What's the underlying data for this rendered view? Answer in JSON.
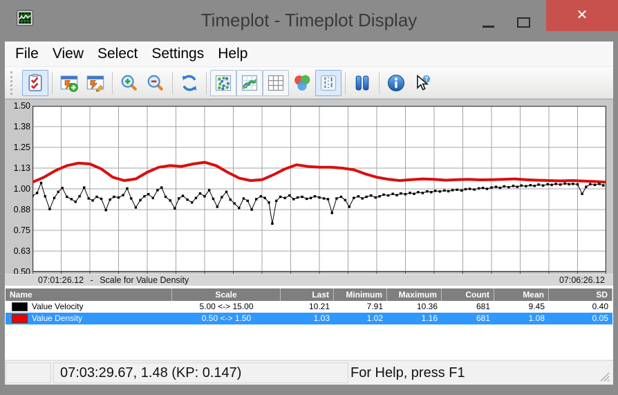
{
  "window": {
    "title": "Timeplot - Timeplot Display",
    "controls": {
      "minimize": "minimize",
      "maximize": "maximize",
      "close_glyph": "✕"
    },
    "colors": {
      "titlebar": "#8b8b8b",
      "close_button": "#c9514d",
      "selection_blue": "#2f97fe",
      "plot_red": "#d90f0f"
    }
  },
  "menu": {
    "items": [
      "File",
      "View",
      "Select",
      "Settings",
      "Help"
    ]
  },
  "toolbar": {
    "groups": [
      [
        {
          "name": "select-plots-button",
          "icon": "checklist-icon",
          "style": "selected"
        }
      ],
      [
        {
          "name": "add-plot-button",
          "icon": "add-plot-icon",
          "style": "plain"
        },
        {
          "name": "edit-plot-button",
          "icon": "edit-plot-icon",
          "style": "plain"
        }
      ],
      [
        {
          "name": "zoom-in-button",
          "icon": "zoom-in-icon",
          "style": "plain"
        },
        {
          "name": "zoom-out-button",
          "icon": "zoom-out-icon",
          "style": "plain"
        }
      ],
      [
        {
          "name": "refresh-button",
          "icon": "refresh-icon",
          "style": "plain"
        }
      ],
      [
        {
          "name": "scatter-style-button",
          "icon": "scatter-plot-icon",
          "style": "framed"
        },
        {
          "name": "line-style-button",
          "icon": "line-plot-icon",
          "style": "framed"
        },
        {
          "name": "grid-toggle-button",
          "icon": "grid-icon",
          "style": "framed"
        },
        {
          "name": "color-mix-button",
          "icon": "color-circles-icon",
          "style": "plain"
        },
        {
          "name": "marker-lines-button",
          "icon": "marker-lines-icon",
          "style": "selected"
        }
      ],
      [
        {
          "name": "pause-button",
          "icon": "pause-icon",
          "style": "plain"
        }
      ],
      [
        {
          "name": "info-button",
          "icon": "info-icon",
          "style": "plain"
        },
        {
          "name": "context-help-button",
          "icon": "help-cursor-icon",
          "style": "plain"
        }
      ]
    ]
  },
  "chart_data": {
    "type": "line",
    "title": "",
    "x_axis": {
      "start_label": "07:01:26.12",
      "end_label": "07:06:26.12",
      "separator": "-",
      "divisions": 20
    },
    "y_axis": {
      "min": 0.5,
      "max": 1.5,
      "tick_labels": [
        "1.50",
        "1.38",
        "1.25",
        "1.13",
        "1.00",
        "0.88",
        "0.75",
        "0.63",
        "0.50"
      ],
      "tick_values": [
        1.5,
        1.375,
        1.25,
        1.125,
        1.0,
        0.875,
        0.75,
        0.625,
        0.5
      ],
      "scale_label": "Scale for Value Density"
    },
    "grid": true,
    "series": [
      {
        "name": "Value Velocity",
        "color": "#000000",
        "marker": "square",
        "line_width": 1,
        "scale_min": 5.0,
        "scale_max": 15.0,
        "points": [
          [
            0.0,
            9.58
          ],
          [
            0.008,
            9.75
          ],
          [
            0.015,
            10.36
          ],
          [
            0.022,
            9.55
          ],
          [
            0.03,
            8.78
          ],
          [
            0.038,
            9.45
          ],
          [
            0.045,
            9.82
          ],
          [
            0.052,
            10.05
          ],
          [
            0.06,
            9.52
          ],
          [
            0.068,
            9.38
          ],
          [
            0.075,
            9.22
          ],
          [
            0.082,
            9.55
          ],
          [
            0.09,
            10.08
          ],
          [
            0.098,
            9.42
          ],
          [
            0.105,
            9.3
          ],
          [
            0.112,
            9.52
          ],
          [
            0.12,
            9.4
          ],
          [
            0.128,
            8.72
          ],
          [
            0.135,
            9.35
          ],
          [
            0.142,
            9.52
          ],
          [
            0.15,
            9.48
          ],
          [
            0.158,
            9.62
          ],
          [
            0.165,
            10.02
          ],
          [
            0.172,
            9.42
          ],
          [
            0.18,
            8.88
          ],
          [
            0.188,
            9.32
          ],
          [
            0.195,
            9.55
          ],
          [
            0.202,
            9.68
          ],
          [
            0.21,
            9.45
          ],
          [
            0.218,
            9.92
          ],
          [
            0.225,
            10.08
          ],
          [
            0.232,
            9.52
          ],
          [
            0.24,
            9.3
          ],
          [
            0.248,
            8.82
          ],
          [
            0.255,
            9.42
          ],
          [
            0.262,
            9.58
          ],
          [
            0.27,
            9.35
          ],
          [
            0.278,
            9.18
          ],
          [
            0.285,
            9.45
          ],
          [
            0.292,
            9.72
          ],
          [
            0.3,
            9.55
          ],
          [
            0.308,
            9.92
          ],
          [
            0.315,
            9.4
          ],
          [
            0.322,
            8.92
          ],
          [
            0.33,
            9.5
          ],
          [
            0.338,
            9.82
          ],
          [
            0.345,
            9.35
          ],
          [
            0.352,
            9.12
          ],
          [
            0.36,
            8.85
          ],
          [
            0.368,
            9.42
          ],
          [
            0.375,
            9.28
          ],
          [
            0.382,
            8.75
          ],
          [
            0.39,
            9.38
          ],
          [
            0.398,
            9.55
          ],
          [
            0.405,
            9.45
          ],
          [
            0.412,
            9.18
          ],
          [
            0.418,
            7.91
          ],
          [
            0.425,
            9.28
          ],
          [
            0.432,
            9.52
          ],
          [
            0.44,
            9.45
          ],
          [
            0.448,
            9.6
          ],
          [
            0.455,
            9.38
          ],
          [
            0.462,
            9.48
          ],
          [
            0.47,
            9.52
          ],
          [
            0.478,
            9.4
          ],
          [
            0.485,
            9.45
          ],
          [
            0.492,
            9.55
          ],
          [
            0.5,
            9.48
          ],
          [
            0.508,
            9.42
          ],
          [
            0.515,
            9.38
          ],
          [
            0.522,
            8.55
          ],
          [
            0.53,
            9.42
          ],
          [
            0.538,
            9.52
          ],
          [
            0.545,
            9.32
          ],
          [
            0.552,
            8.92
          ],
          [
            0.56,
            9.45
          ],
          [
            0.568,
            9.55
          ],
          [
            0.575,
            9.42
          ],
          [
            0.582,
            9.52
          ],
          [
            0.59,
            9.6
          ],
          [
            0.598,
            9.48
          ],
          [
            0.605,
            9.55
          ],
          [
            0.612,
            9.65
          ],
          [
            0.62,
            9.6
          ],
          [
            0.628,
            9.7
          ],
          [
            0.635,
            9.62
          ],
          [
            0.642,
            9.72
          ],
          [
            0.65,
            9.68
          ],
          [
            0.658,
            9.76
          ],
          [
            0.665,
            9.7
          ],
          [
            0.672,
            9.8
          ],
          [
            0.68,
            9.75
          ],
          [
            0.688,
            9.85
          ],
          [
            0.695,
            9.8
          ],
          [
            0.702,
            9.88
          ],
          [
            0.71,
            9.84
          ],
          [
            0.718,
            9.9
          ],
          [
            0.725,
            9.86
          ],
          [
            0.732,
            9.92
          ],
          [
            0.74,
            9.95
          ],
          [
            0.748,
            9.9
          ],
          [
            0.755,
            9.98
          ],
          [
            0.762,
            10.0
          ],
          [
            0.77,
            9.96
          ],
          [
            0.778,
            10.03
          ],
          [
            0.785,
            10.06
          ],
          [
            0.792,
            10.0
          ],
          [
            0.8,
            10.08
          ],
          [
            0.808,
            10.12
          ],
          [
            0.815,
            10.06
          ],
          [
            0.822,
            10.15
          ],
          [
            0.83,
            10.1
          ],
          [
            0.838,
            10.18
          ],
          [
            0.845,
            10.12
          ],
          [
            0.852,
            10.2
          ],
          [
            0.86,
            10.16
          ],
          [
            0.868,
            10.22
          ],
          [
            0.875,
            10.18
          ],
          [
            0.882,
            10.26
          ],
          [
            0.89,
            10.2
          ],
          [
            0.898,
            10.28
          ],
          [
            0.905,
            10.24
          ],
          [
            0.912,
            10.3
          ],
          [
            0.92,
            10.26
          ],
          [
            0.928,
            10.32
          ],
          [
            0.935,
            10.28
          ],
          [
            0.942,
            10.3
          ],
          [
            0.95,
            10.27
          ],
          [
            0.958,
            9.7
          ],
          [
            0.965,
            10.12
          ],
          [
            0.972,
            10.28
          ],
          [
            0.98,
            10.24
          ],
          [
            0.988,
            10.3
          ],
          [
            0.995,
            10.21
          ]
        ]
      },
      {
        "name": "Value Density",
        "color": "#d90f0f",
        "marker": "none",
        "line_width": 4,
        "scale_min": 0.5,
        "scale_max": 1.5,
        "points": [
          [
            0.0,
            1.04
          ],
          [
            0.02,
            1.07
          ],
          [
            0.04,
            1.11
          ],
          [
            0.06,
            1.14
          ],
          [
            0.08,
            1.155
          ],
          [
            0.1,
            1.15
          ],
          [
            0.12,
            1.12
          ],
          [
            0.14,
            1.07
          ],
          [
            0.16,
            1.05
          ],
          [
            0.18,
            1.06
          ],
          [
            0.2,
            1.1
          ],
          [
            0.22,
            1.13
          ],
          [
            0.24,
            1.14
          ],
          [
            0.26,
            1.135
          ],
          [
            0.28,
            1.15
          ],
          [
            0.3,
            1.16
          ],
          [
            0.32,
            1.14
          ],
          [
            0.34,
            1.1
          ],
          [
            0.36,
            1.065
          ],
          [
            0.38,
            1.05
          ],
          [
            0.4,
            1.055
          ],
          [
            0.42,
            1.085
          ],
          [
            0.44,
            1.12
          ],
          [
            0.46,
            1.145
          ],
          [
            0.48,
            1.135
          ],
          [
            0.5,
            1.13
          ],
          [
            0.52,
            1.13
          ],
          [
            0.54,
            1.125
          ],
          [
            0.56,
            1.115
          ],
          [
            0.58,
            1.09
          ],
          [
            0.6,
            1.07
          ],
          [
            0.62,
            1.058
          ],
          [
            0.64,
            1.05
          ],
          [
            0.66,
            1.055
          ],
          [
            0.68,
            1.06
          ],
          [
            0.7,
            1.057
          ],
          [
            0.72,
            1.052
          ],
          [
            0.74,
            1.055
          ],
          [
            0.76,
            1.057
          ],
          [
            0.78,
            1.054
          ],
          [
            0.8,
            1.055
          ],
          [
            0.82,
            1.057
          ],
          [
            0.84,
            1.06
          ],
          [
            0.86,
            1.055
          ],
          [
            0.88,
            1.052
          ],
          [
            0.9,
            1.05
          ],
          [
            0.92,
            1.048
          ],
          [
            0.94,
            1.05
          ],
          [
            0.96,
            1.047
          ],
          [
            0.98,
            1.044
          ],
          [
            1.0,
            1.04
          ]
        ]
      }
    ]
  },
  "table": {
    "columns": [
      {
        "label": "Name",
        "align": "al"
      },
      {
        "label": "Scale",
        "align": "ac"
      },
      {
        "label": "Last",
        "align": "ar"
      },
      {
        "label": "Minimum",
        "align": "ar"
      },
      {
        "label": "Maximum",
        "align": "ar"
      },
      {
        "label": "Count",
        "align": "ar"
      },
      {
        "label": "Mean",
        "align": "ar"
      },
      {
        "label": "SD",
        "align": "ar"
      }
    ],
    "rows": [
      {
        "swatch": "#000000",
        "selected": false,
        "cells": [
          "Value Velocity",
          "5.00 <-> 15.00",
          "10.21",
          "7.91",
          "10.36",
          "681",
          "9.45",
          "0.40"
        ]
      },
      {
        "swatch": "#ee0000",
        "selected": true,
        "cells": [
          "Value Density",
          "0.50 <-> 1.50",
          "1.03",
          "1.02",
          "1.16",
          "681",
          "1.08",
          "0.05"
        ]
      }
    ]
  },
  "status_bar": {
    "time_text": "07:03:29.67, 1.48 (KP: 0.147)",
    "help_text": "For Help, press F1"
  }
}
